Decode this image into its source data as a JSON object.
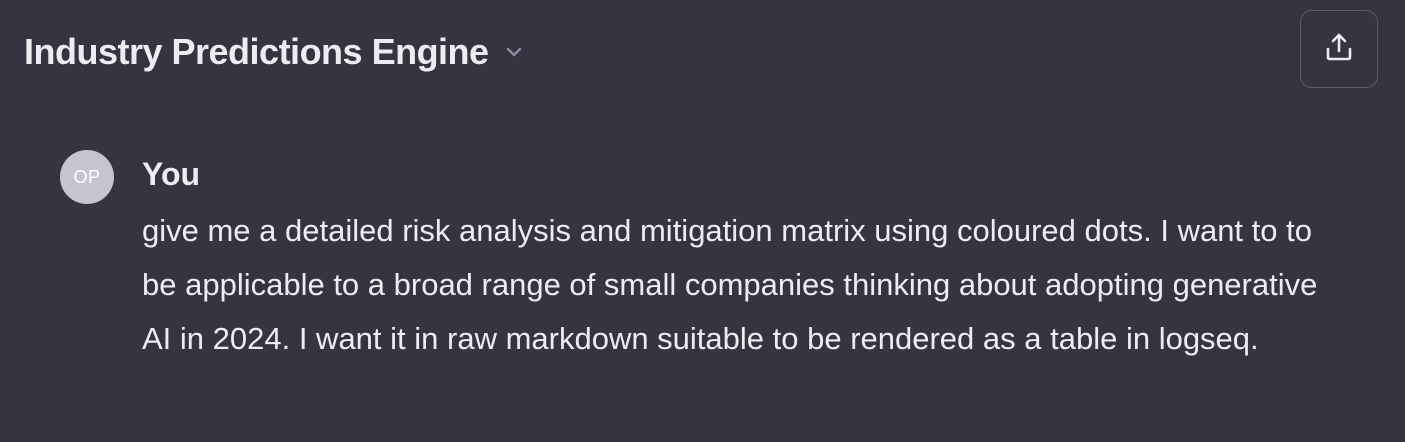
{
  "header": {
    "title": "Industry Predictions Engine",
    "dropdown_icon": "chevron-down-icon",
    "share_icon": "share-upload-icon"
  },
  "message": {
    "avatar_initials": "OP",
    "author": "You",
    "text": "give me a detailed risk analysis and mitigation matrix using coloured dots. I want to to be applicable to a broad range of small companies thinking about adopting generative AI in 2024. I want it in raw markdown suitable to be rendered as a table in logseq."
  },
  "colors": {
    "background": "#343541",
    "text": "#ececf1",
    "avatar_bg": "#c5c5d2",
    "border": "#5c5d68"
  }
}
